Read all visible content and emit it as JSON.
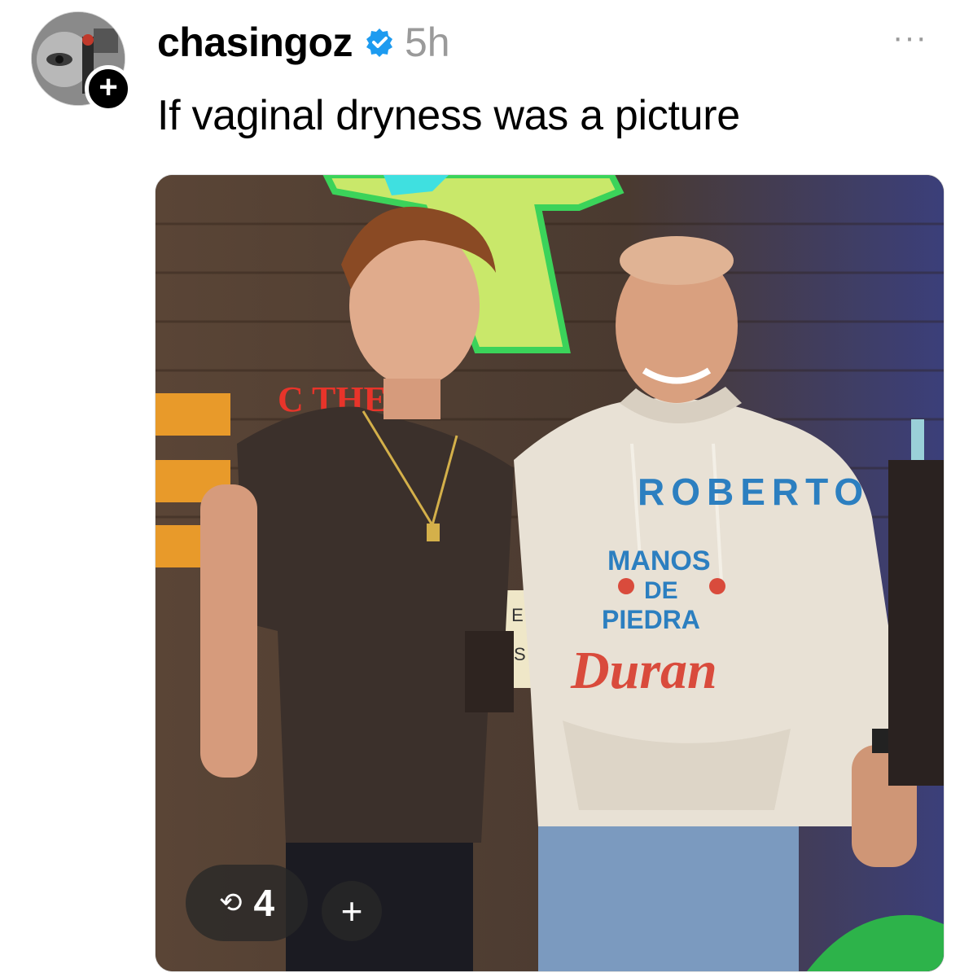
{
  "post": {
    "username": "chasingoz",
    "timestamp": "5h",
    "caption": "If vaginal dryness was a picture",
    "verified_icon": "verified-badge-icon",
    "more_icon": "more-options-icon",
    "more_glyph": "···",
    "follow_glyph": "+"
  },
  "media": {
    "repost_count": "4",
    "repost_glyph": "⟲",
    "add_glyph": "+",
    "hoodie_text": {
      "arc": "ROBERTO",
      "line1": "MANOS",
      "line2": "DE",
      "line3": "PIEDRA",
      "script": "Duran"
    },
    "sign_text_1": "T E",
    "sign_text_2": "U S"
  },
  "colors": {
    "verified_blue": "#1d9bf0",
    "timestamp_gray": "#9a9a9a",
    "hoodie_blue": "#2c7fc0",
    "hoodie_red": "#d94b3c"
  }
}
